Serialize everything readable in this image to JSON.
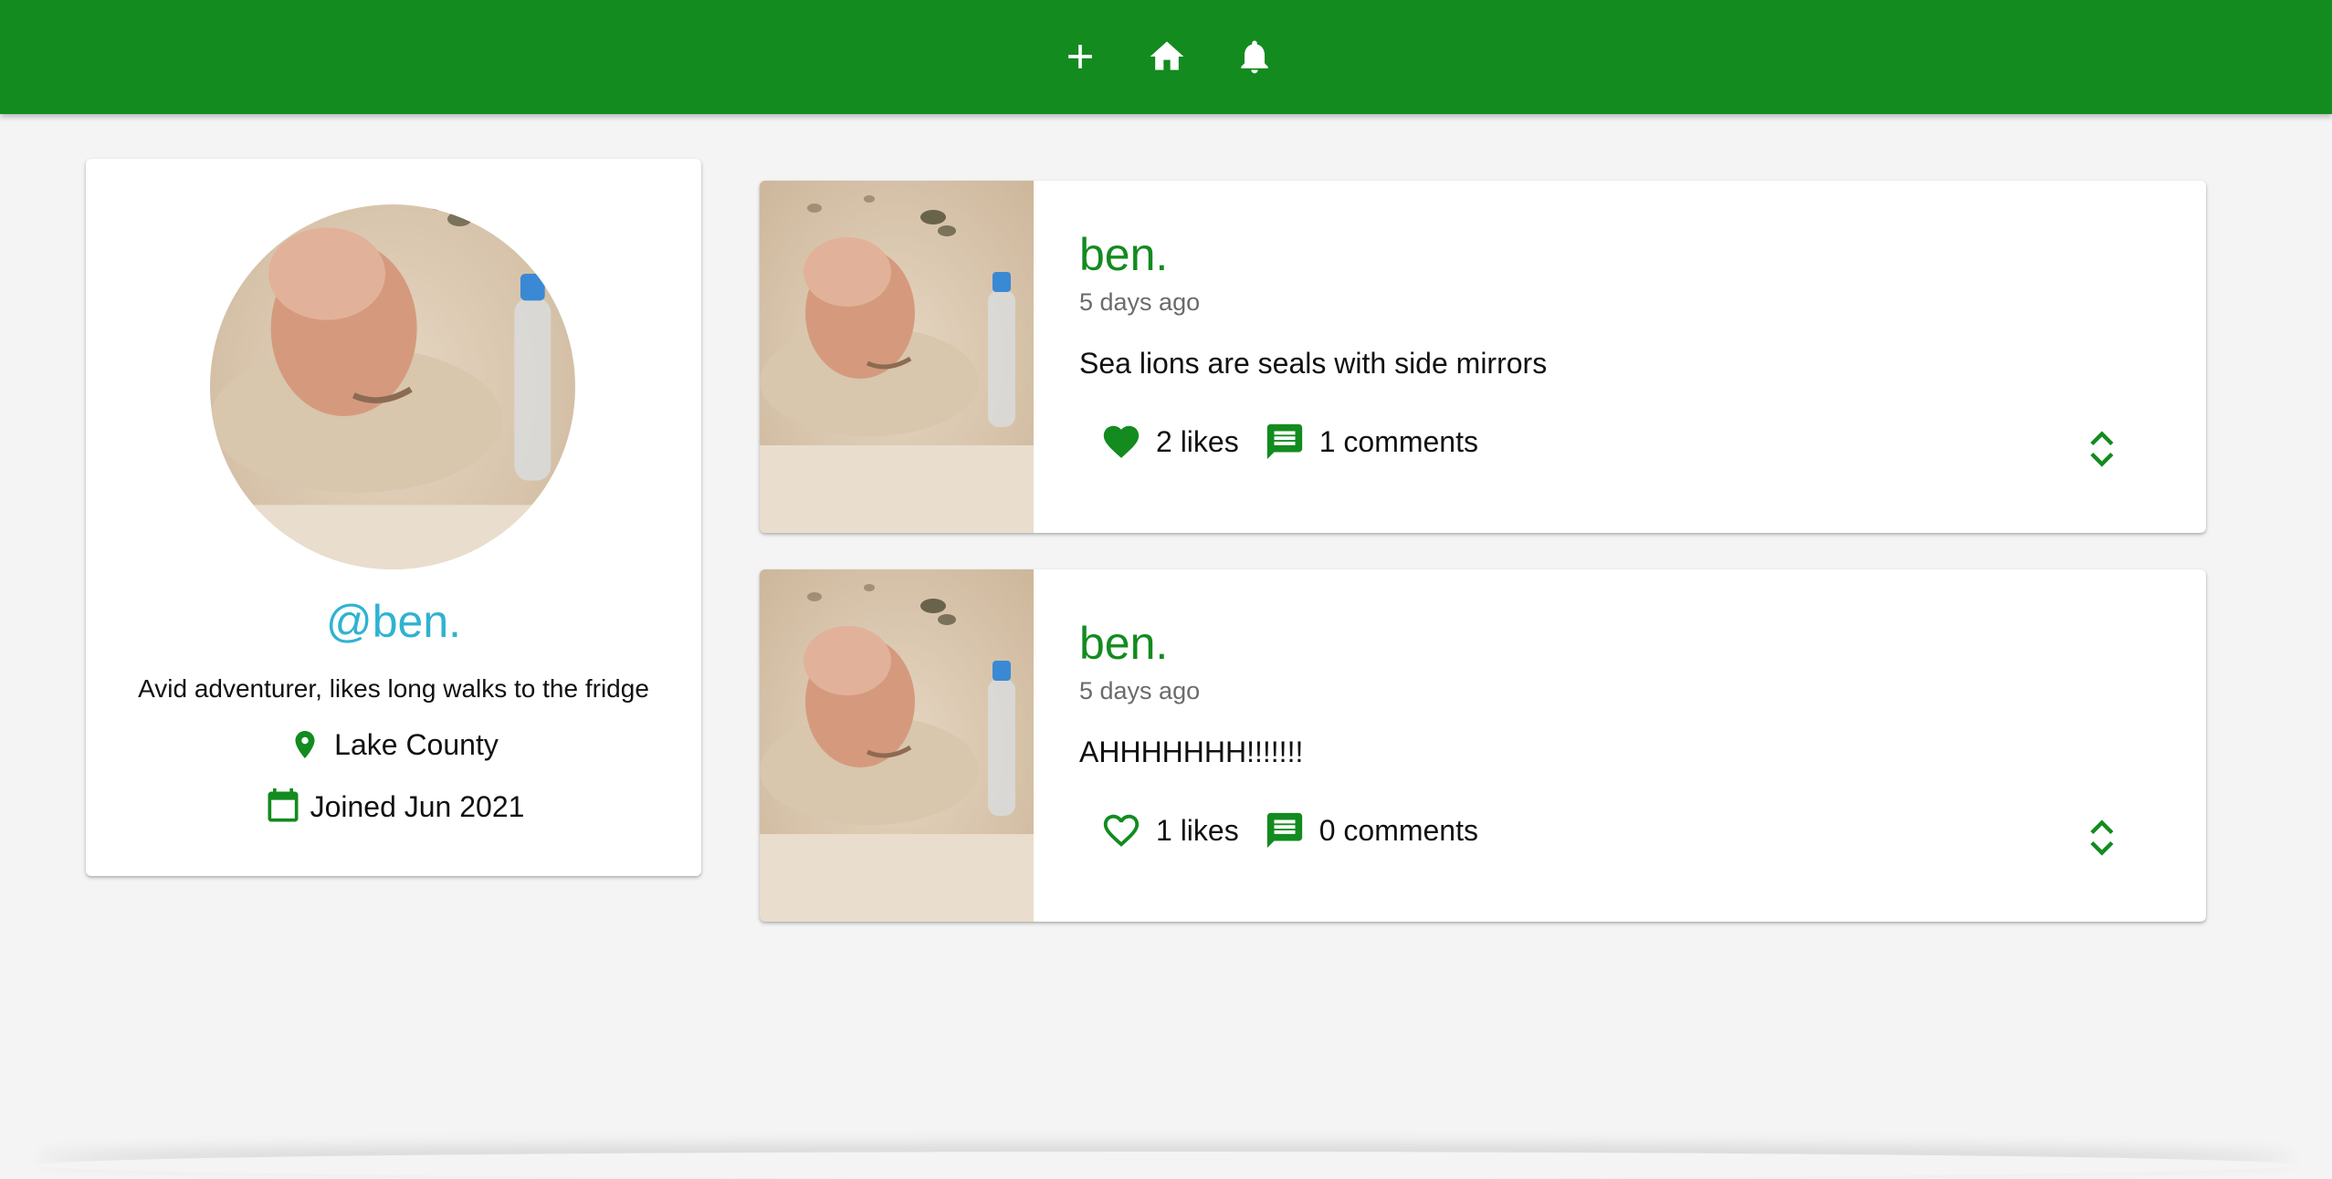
{
  "colors": {
    "brand": "#138b1f",
    "handle": "#2fb3d1",
    "background": "#f4f4f4"
  },
  "appbar": {
    "icons": [
      "plus-icon",
      "home-icon",
      "bell-icon"
    ]
  },
  "profile": {
    "handle": "@ben.",
    "bio": "Avid adventurer, likes long walks to the fridge",
    "location": "Lake County",
    "joined": "Joined Jun 2021"
  },
  "posts": [
    {
      "author": "ben.",
      "time": "5 days ago",
      "body": "Sea lions are seals with side mirrors",
      "likes": "2 likes",
      "comments": "1 comments",
      "liked": true
    },
    {
      "author": "ben.",
      "time": "5 days ago",
      "body": "AHHHHHHH!!!!!!!",
      "likes": "1 likes",
      "comments": "0 comments",
      "liked": false
    }
  ]
}
